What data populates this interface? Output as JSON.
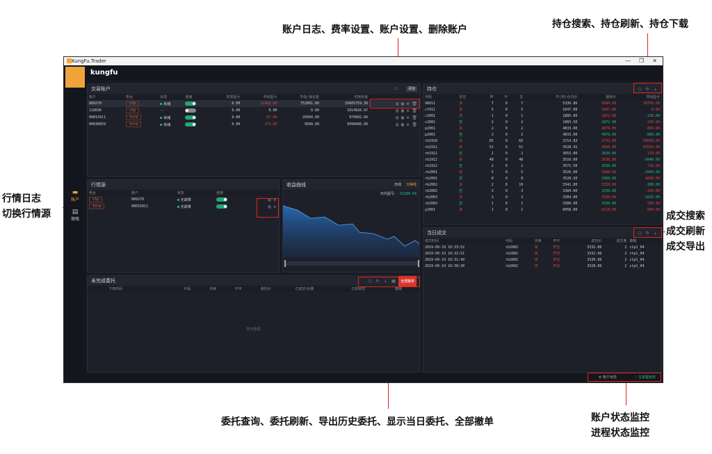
{
  "annotations": {
    "account_ops": "账户日志、费率设置、账户设置、删除账户",
    "position_ops": "持仓搜索、持仓刷新、持仓下载",
    "md_ops_1": "行情日志",
    "md_ops_2": "切换行情源",
    "trade_ops_1": "成交搜索",
    "trade_ops_2": "成交刷新",
    "trade_ops_3": "成交导出",
    "order_ops": "委托查询、委托刷新、导出历史委托、显示当日委托、全部撤单",
    "monitor_1": "账户状态监控",
    "monitor_2": "进程状态监控"
  },
  "window": {
    "title": "KungFu.Trader",
    "brand": "kungfu"
  },
  "sidebar": [
    {
      "label": "账户"
    },
    {
      "label": "策略"
    }
  ],
  "accounts": {
    "title": "交易账户",
    "add": "添加",
    "columns": [
      "账户",
      "柜台",
      "状态",
      "连接",
      "实现盈亏",
      "浮动盈亏",
      "市值/保证金",
      "可用资金"
    ],
    "rows": [
      {
        "id": "089270",
        "src": "ctp",
        "status": "就绪",
        "on": true,
        "real": "0.00",
        "float": "21460.00",
        "margin": "752001.00",
        "avail": "10605759.36",
        "fc": "red"
      },
      {
        "id": "118036",
        "src": "ctp",
        "status": "--",
        "on": false,
        "real": "0.00",
        "float": "0.00",
        "margin": "0.00",
        "avail": "1014826.97",
        "fc": ""
      },
      {
        "id": "00015011",
        "src": "tora",
        "status": "就绪",
        "on": true,
        "real": "0.00",
        "float": "67.00",
        "margin": "20994.00",
        "avail": "979002.66",
        "fc": "red"
      },
      {
        "id": "00030059",
        "src": "tora",
        "status": "就绪",
        "on": true,
        "real": "0.00",
        "float": "174.00",
        "margin": "9568.00",
        "avail": "9990606.00",
        "fc": "red"
      }
    ]
  },
  "md": {
    "title": "行情源",
    "columns": [
      "柜台",
      "账户",
      "状态",
      "连接"
    ],
    "rows": [
      {
        "src": "ctp",
        "id": "089270",
        "status": "无故障"
      },
      {
        "src": "tora",
        "id": "00015011",
        "status": "无故障"
      }
    ]
  },
  "pnl": {
    "title": "收益曲线",
    "tab1": "日线",
    "tab2": "分钟线",
    "label": "日内盈亏：",
    "value": "-32280.64"
  },
  "positions": {
    "title": "持仓",
    "columns": [
      "代码",
      "多空",
      "昨",
      "今",
      "总",
      "开(持)仓均价",
      "最新价",
      "浮动盈亏"
    ],
    "rows": [
      [
        "SR011",
        "多",
        "7",
        "0",
        "7",
        "5330.86",
        "5684.00",
        "18700.00",
        "red",
        "red"
      ],
      [
        "cf911",
        "多",
        "5",
        "0",
        "5",
        "1047.00",
        "1047.00",
        "0.00",
        "red",
        "red"
      ],
      [
        "c2001",
        "多",
        "1",
        "0",
        "1",
        "1885.00",
        "1872.00",
        "-130.00",
        "red",
        "green"
      ],
      [
        "c2001",
        "空",
        "2",
        "0",
        "2",
        "1883.50",
        "1872.00",
        "230.00",
        "green",
        "red"
      ],
      [
        "p2001",
        "多",
        "2",
        "0",
        "2",
        "4833.00",
        "4876.00",
        "860.00",
        "red",
        "red"
      ],
      [
        "p2001",
        "空",
        "2",
        "0",
        "2",
        "4833.00",
        "4876.00",
        "-860.00",
        "green",
        "green"
      ],
      [
        "rb1910",
        "多",
        "65",
        "0",
        "65",
        "3714.83",
        "3793.00",
        "50500.00",
        "red",
        "red"
      ],
      [
        "rb1911",
        "多",
        "51",
        "0",
        "51",
        "3528.41",
        "3636.00",
        "43550.00",
        "red",
        "red"
      ],
      [
        "rb1911",
        "空",
        "1",
        "0",
        "1",
        "3653.00",
        "3636.00",
        "170.00",
        "green",
        "red"
      ],
      [
        "rb1912",
        "多",
        "48",
        "0",
        "48",
        "3516.60",
        "3536.00",
        "-5840.00",
        "red",
        "green"
      ],
      [
        "rb1912",
        "空",
        "2",
        "0",
        "2",
        "3571.50",
        "3536.00",
        "710.00",
        "green",
        "red"
      ],
      [
        "rb2001",
        "多",
        "5",
        "0",
        "5",
        "3526.00",
        "3468.00",
        "-2940.00",
        "red",
        "green"
      ],
      [
        "rb2001",
        "空",
        "8",
        "0",
        "8",
        "3528.50",
        "3468.00",
        "4840.00",
        "green",
        "red"
      ],
      [
        "rb2002",
        "多",
        "2",
        "8",
        "10",
        "3342.00",
        "3339.00",
        "-300.00",
        "red",
        "green"
      ],
      [
        "rb2002",
        "空",
        "3",
        "0",
        "3",
        "3384.00",
        "3339.00",
        "430.00",
        "green",
        "red"
      ],
      [
        "rb2003",
        "多",
        "3",
        "0",
        "3",
        "3384.00",
        "3330.00",
        "-1620.00",
        "red",
        "green"
      ],
      [
        "rb2003",
        "空",
        "1",
        "0",
        "1",
        "3380.00",
        "3330.00",
        "500.00",
        "green",
        "red"
      ],
      [
        "y2001",
        "多",
        "1",
        "0",
        "1",
        "6058.00",
        "6118.00",
        "600.00",
        "red",
        "red"
      ]
    ]
  },
  "trades": {
    "title": "当日成交",
    "columns": [
      "成交时间",
      "代码",
      "买卖",
      "开平",
      "成交价",
      "成交量",
      "策略"
    ],
    "rows": [
      [
        "2019-09-19 10:33:52",
        "rb2002",
        "买",
        "开仓",
        "3332.00",
        "2",
        "ctp1_04"
      ],
      [
        "2019-09-19 10:32:51",
        "rb2002",
        "买",
        "开仓",
        "3332.00",
        "2",
        "ctp1_04"
      ],
      [
        "2019-09-19 10:31:49",
        "rb2002",
        "买",
        "开仓",
        "3330.00",
        "2",
        "ctp1_04"
      ],
      [
        "2019-09-19 10:30:30",
        "rb2002",
        "买",
        "开仓",
        "3328.00",
        "2",
        "ctp1_04"
      ]
    ]
  },
  "orders": {
    "title": "未完成委托",
    "cancel_all": "全部撤单",
    "columns": [
      "下单时间",
      "代码",
      "买卖",
      "开平",
      "委托价",
      "已成交/全量",
      "订单状态",
      "策略"
    ],
    "empty": "暂无数据"
  },
  "status_bar": {
    "account": "账户状态",
    "process": "主进程状态"
  }
}
